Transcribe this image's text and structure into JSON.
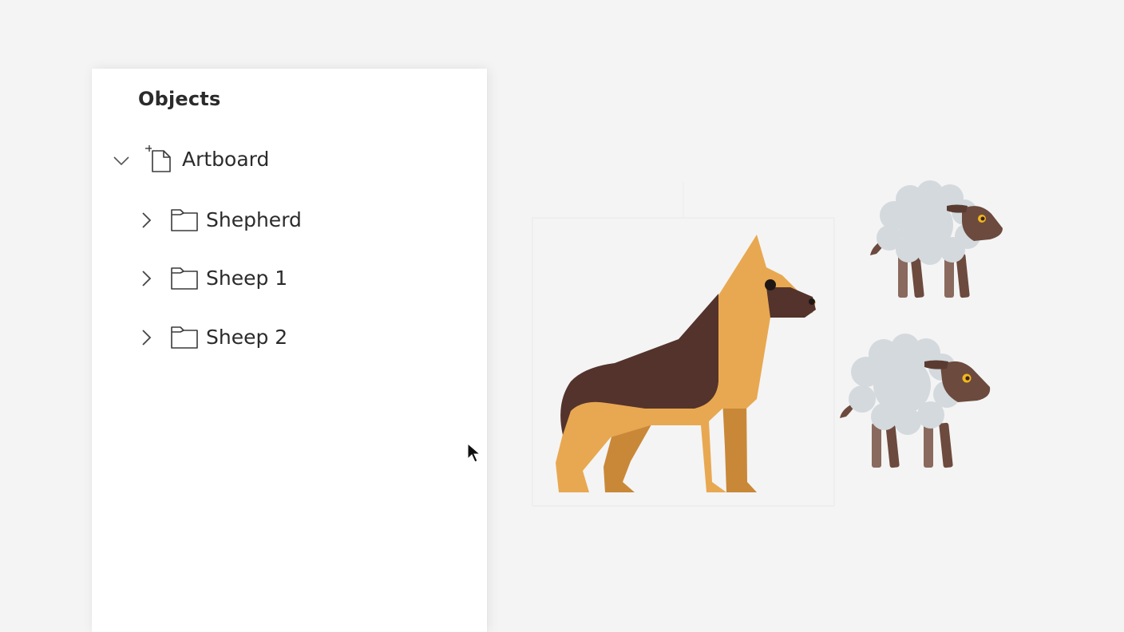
{
  "objects_panel": {
    "title": "Objects",
    "root": {
      "label": "Artboard",
      "expanded": true,
      "icon": "artboard-icon"
    },
    "children": [
      {
        "label": "Shepherd",
        "expanded": false,
        "icon": "folder-icon"
      },
      {
        "label": "Sheep 1",
        "expanded": false,
        "icon": "folder-icon"
      },
      {
        "label": "Sheep 2",
        "expanded": false,
        "icon": "folder-icon"
      }
    ]
  },
  "canvas": {
    "objects": [
      "shepherd-dog-illustration",
      "sheep-illustration",
      "sheep-illustration"
    ]
  },
  "colors": {
    "background": "#f4f4f4",
    "panel": "#ffffff",
    "text": "#2b2b2b",
    "dog_tan": "#e8a851",
    "dog_dark": "#53332c",
    "dog_leg_shadow": "#c98838",
    "sheep_wool": "#d3d9dd",
    "sheep_head": "#6d4a3e",
    "sheep_leg": "#8a6a5e",
    "sheep_eye": "#f2b71c"
  }
}
